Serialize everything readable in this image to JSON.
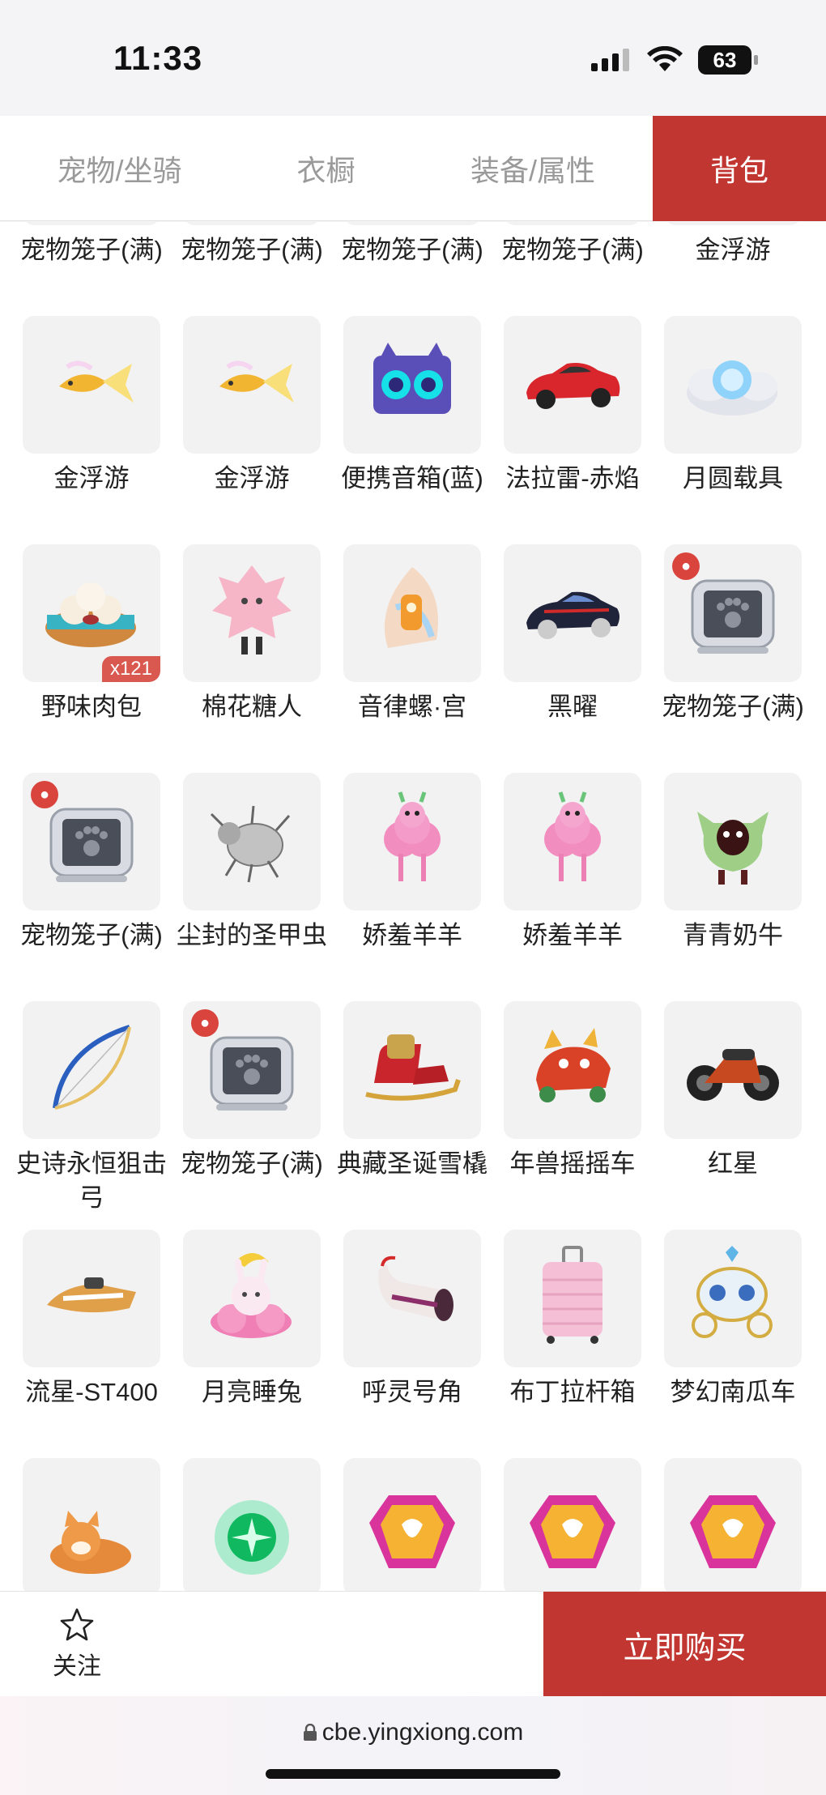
{
  "status": {
    "time": "11:33",
    "battery": "63"
  },
  "tabs": [
    {
      "label": "宠物/坐骑",
      "active": false
    },
    {
      "label": "衣橱",
      "active": false
    },
    {
      "label": "装备/属性",
      "active": false
    },
    {
      "label": "背包",
      "active": true
    }
  ],
  "items": [
    {
      "name": "宠物笼子(满)",
      "icon": "pet-cage-icon"
    },
    {
      "name": "宠物笼子(满)",
      "icon": "pet-cage-icon"
    },
    {
      "name": "宠物笼子(满)",
      "icon": "pet-cage-icon"
    },
    {
      "name": "宠物笼子(满)",
      "icon": "pet-cage-icon"
    },
    {
      "name": "金浮游",
      "icon": "golden-fish-icon"
    },
    {
      "name": "金浮游",
      "icon": "golden-fish-icon"
    },
    {
      "name": "金浮游",
      "icon": "golden-fish-icon"
    },
    {
      "name": "便携音箱(蓝)",
      "icon": "speaker-icon"
    },
    {
      "name": "法拉雷-赤焰",
      "icon": "red-car-icon"
    },
    {
      "name": "月圆载具",
      "icon": "moon-cloud-icon"
    },
    {
      "name": "野味肉包",
      "icon": "bun-basket-icon",
      "qty": "x121"
    },
    {
      "name": "棉花糖人",
      "icon": "pink-figure-icon"
    },
    {
      "name": "音律螺·宫",
      "icon": "conch-icon"
    },
    {
      "name": "黑曜",
      "icon": "black-car-icon"
    },
    {
      "name": "宠物笼子(满)",
      "icon": "pet-cage-icon",
      "badge": true
    },
    {
      "name": "宠物笼子(满)",
      "icon": "pet-cage-icon",
      "badge": true
    },
    {
      "name": "尘封的圣甲虫",
      "icon": "beetle-icon"
    },
    {
      "name": "娇羞羊羊",
      "icon": "pink-sheep-icon"
    },
    {
      "name": "娇羞羊羊",
      "icon": "pink-sheep-icon"
    },
    {
      "name": "青青奶牛",
      "icon": "green-cow-icon"
    },
    {
      "name": "史诗永恒狙击弓",
      "icon": "bow-icon"
    },
    {
      "name": "宠物笼子(满)",
      "icon": "pet-cage-icon",
      "badge": true
    },
    {
      "name": "典藏圣诞雪橇",
      "icon": "sleigh-icon"
    },
    {
      "name": "年兽摇摇车",
      "icon": "dragon-cart-icon"
    },
    {
      "name": "红星",
      "icon": "motorcycle-icon"
    },
    {
      "name": "流星-ST400",
      "icon": "hoverbike-icon"
    },
    {
      "name": "月亮睡兔",
      "icon": "moon-rabbit-icon"
    },
    {
      "name": "呼灵号角",
      "icon": "horn-icon"
    },
    {
      "name": "布丁拉杆箱",
      "icon": "suitcase-icon"
    },
    {
      "name": "梦幻南瓜车",
      "icon": "carriage-icon"
    },
    {
      "name": "",
      "icon": "shiba-dog-icon"
    },
    {
      "name": "",
      "icon": "green-orb-icon"
    },
    {
      "name": "",
      "icon": "gem-icon"
    },
    {
      "name": "",
      "icon": "gem-icon"
    },
    {
      "name": "",
      "icon": "gem-icon"
    }
  ],
  "actions": {
    "follow_label": "关注",
    "buy_label": "立即购买"
  },
  "browser": {
    "url": "cbe.yingxiong.com"
  },
  "colors": {
    "accent": "#c23632",
    "thumb_bg": "#f2f2f3"
  }
}
